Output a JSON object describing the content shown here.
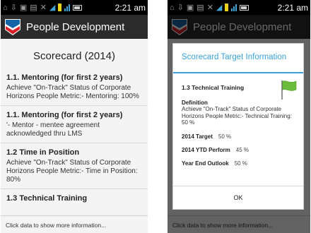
{
  "status_bar": {
    "time": "2:21 am"
  },
  "app": {
    "title": "People Development"
  },
  "scorecard": {
    "title": "Scorecard (2014)",
    "items": [
      {
        "title": "1.1. Mentoring (for first 2 years)",
        "desc": "Achieve \"On-Track\" Status of Corporate Horizons People Metric:- Mentoring: 100%"
      },
      {
        "title": "1.1. Mentoring (for first 2 years)",
        "desc": "'- Mentor - mentee agreement acknowledged thru LMS"
      },
      {
        "title": "1.2 Time in Position",
        "desc": "Achieve \"On-Track\" Status of Corporate Horizons People Metric:- Time in Position: 80%"
      },
      {
        "title": "1.3 Technical Training",
        "desc": ""
      }
    ]
  },
  "footer": {
    "text": "Click data to show more information..."
  },
  "dialog": {
    "title": "Scorecard Target Information",
    "section": "1.3 Technical Training",
    "definition_label": "Definition",
    "definition_text": "Achieve \"On-Track\" Status of Corporate Horizons People Metric:- Technical Training: 50 %",
    "target_label": "2014 Target",
    "target_value": "50 %",
    "ytd_label": "2014 YTD Perform",
    "ytd_value": "45 %",
    "outlook_label": "Year End Outlook",
    "outlook_value": "50 %",
    "ok_label": "OK"
  }
}
